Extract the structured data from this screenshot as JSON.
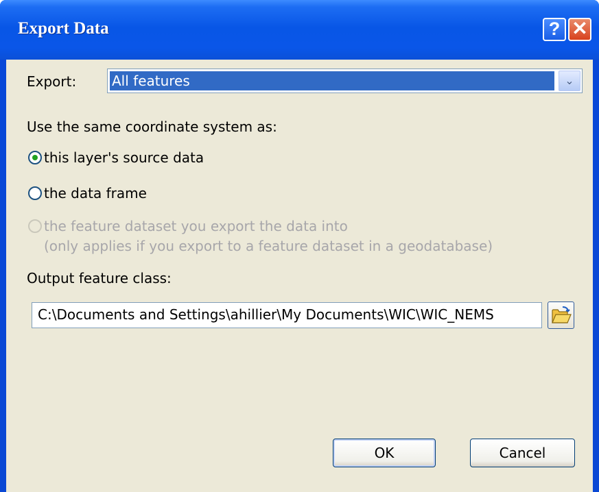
{
  "window": {
    "title": "Export Data"
  },
  "titlebar": {
    "help_glyph": "?",
    "close_glyph": "✕"
  },
  "export": {
    "label": "Export:",
    "selected": "All features",
    "arrow_glyph": "⌄"
  },
  "coordinate_system": {
    "heading": "Use the same coordinate system as:",
    "options": [
      {
        "label": "this layer's source data",
        "checked": true,
        "enabled": true
      },
      {
        "label": "the data frame",
        "checked": false,
        "enabled": true
      },
      {
        "label": "the feature dataset you export the data into",
        "note": "(only applies if you export to a feature dataset in a geodatabase)",
        "checked": false,
        "enabled": false
      }
    ]
  },
  "output": {
    "label": "Output feature class:",
    "value": "C:\\Documents and Settings\\ahillier\\My Documents\\WIC\\WIC_NEMS"
  },
  "buttons": {
    "ok": "OK",
    "cancel": "Cancel"
  },
  "colors": {
    "titlebar_blue": "#0a56e8",
    "dialog_bg": "#ece9d8",
    "selection": "#316ac5",
    "radio_dot": "#21a121"
  },
  "icons": [
    "help-icon",
    "close-icon",
    "dropdown-arrow-icon",
    "open-folder-icon"
  ]
}
